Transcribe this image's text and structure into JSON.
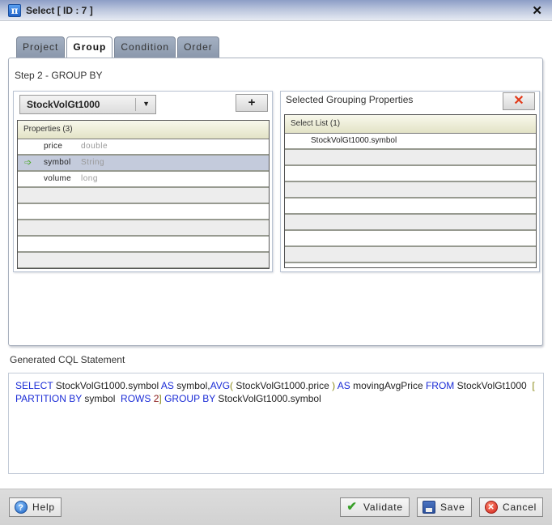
{
  "window": {
    "title": "Select [ ID : 7 ]",
    "icon": "pi-icon",
    "close_icon": "close-icon"
  },
  "tabs": [
    {
      "label": "Project",
      "active": false
    },
    {
      "label": "Group",
      "active": true
    },
    {
      "label": "Condition",
      "active": false
    },
    {
      "label": "Order",
      "active": false
    }
  ],
  "step_label": "Step 2 - GROUP BY",
  "left_panel": {
    "source_dropdown": {
      "value": "StockVolGt1000"
    },
    "add_button_label": "+",
    "grid_header": "Properties (3)",
    "properties": [
      {
        "name": "price",
        "type": "double",
        "selected": false
      },
      {
        "name": "symbol",
        "type": "String",
        "selected": true
      },
      {
        "name": "volume",
        "type": "long",
        "selected": false
      }
    ]
  },
  "right_panel": {
    "title": "Selected Grouping Properties",
    "remove_button_label": "✕",
    "grid_header": "Select List (1)",
    "items": [
      "StockVolGt1000.symbol"
    ]
  },
  "cql": {
    "label": "Generated CQL Statement",
    "tokens": [
      {
        "t": "SELECT",
        "c": "kw"
      },
      {
        "t": " StockVolGt1000.symbol ",
        "c": ""
      },
      {
        "t": "AS",
        "c": "kw"
      },
      {
        "t": " symbol,",
        "c": ""
      },
      {
        "t": "AVG",
        "c": "kw"
      },
      {
        "t": "(",
        "c": "paren"
      },
      {
        "t": " StockVolGt1000.price ",
        "c": ""
      },
      {
        "t": ")",
        "c": "paren"
      },
      {
        "t": " AS",
        "c": "kw"
      },
      {
        "t": " movingAvgPrice ",
        "c": ""
      },
      {
        "t": "FROM",
        "c": "kw"
      },
      {
        "t": " StockVolGt1000  ",
        "c": ""
      },
      {
        "t": "[",
        "c": "paren"
      },
      {
        "t": "\n",
        "c": "br"
      },
      {
        "t": "PARTITION BY",
        "c": "kw"
      },
      {
        "t": " symbol  ",
        "c": ""
      },
      {
        "t": "ROWS",
        "c": "kw"
      },
      {
        "t": " ",
        "c": ""
      },
      {
        "t": "2",
        "c": "num"
      },
      {
        "t": "]",
        "c": "paren"
      },
      {
        "t": " GROUP BY",
        "c": "kw"
      },
      {
        "t": " StockVolGt1000.symbol",
        "c": ""
      }
    ]
  },
  "footer": {
    "help_label": "Help",
    "validate_label": "Validate",
    "save_label": "Save",
    "cancel_label": "Cancel"
  }
}
